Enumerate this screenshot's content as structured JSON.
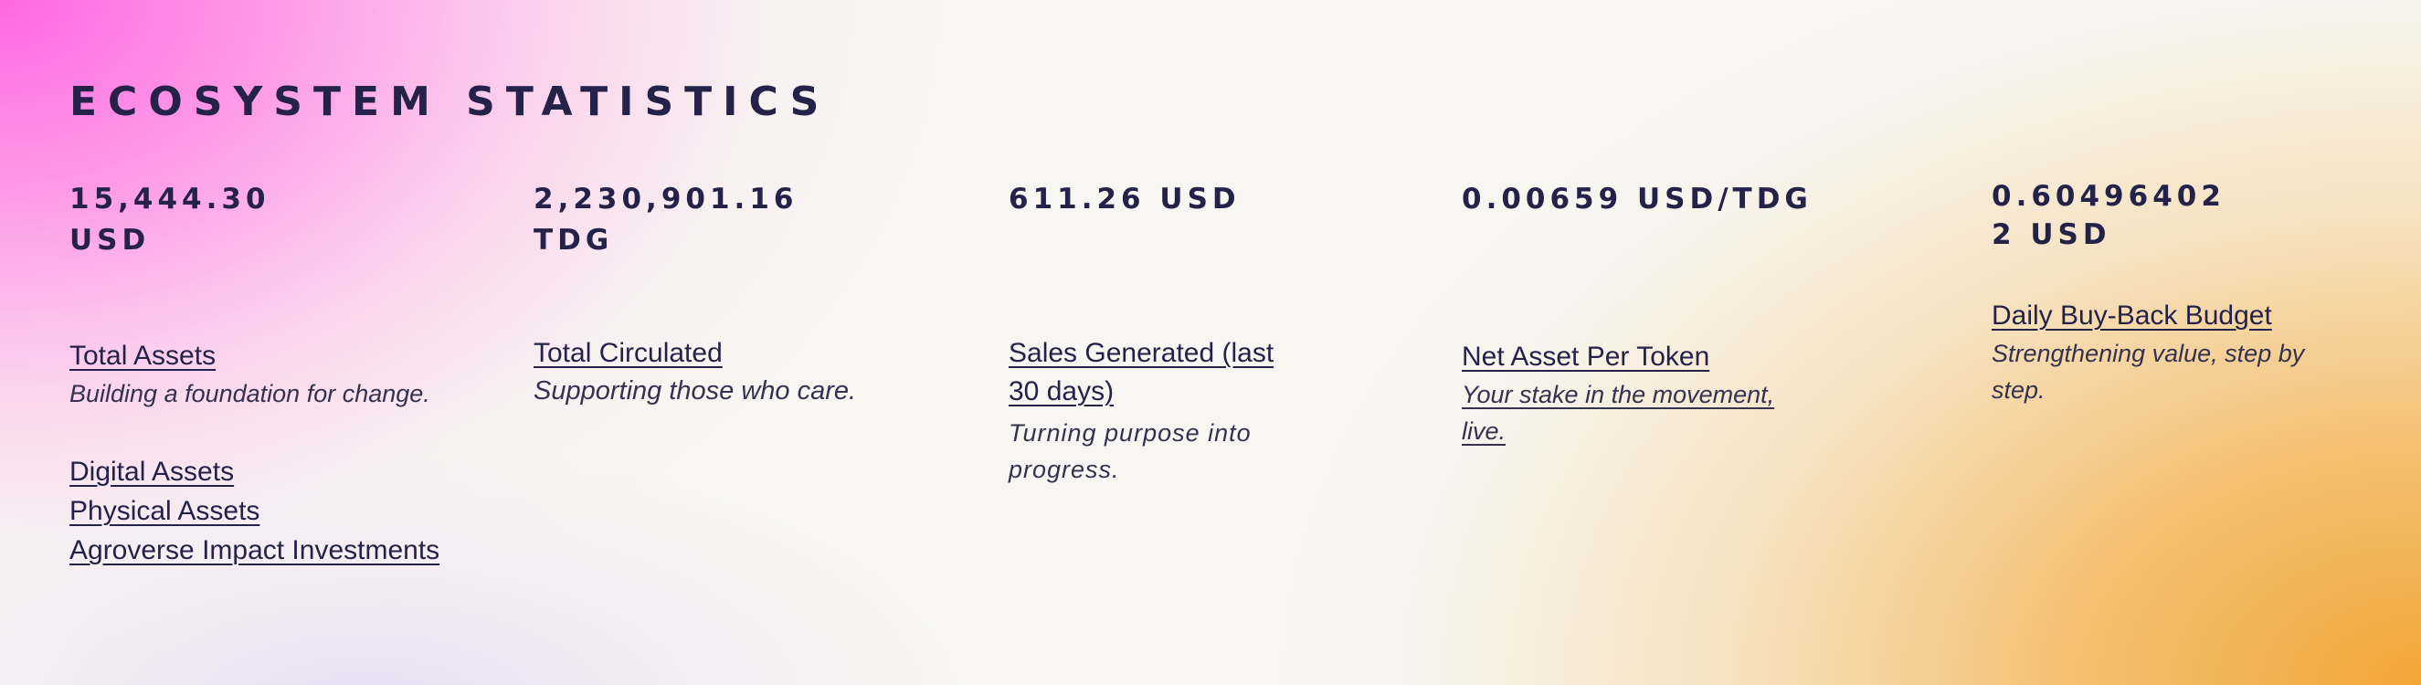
{
  "section": {
    "title": "ECOSYSTEM STATISTICS"
  },
  "stats": [
    {
      "value_line1": "15,444.30",
      "value_line2": "USD",
      "label": "Total Assets",
      "description": "Building a foundation for change.",
      "links": [
        "Digital Assets",
        "Physical Assets",
        "Agroverse Impact Investments"
      ]
    },
    {
      "value_line1": "2,230,901.16",
      "value_line2": "TDG",
      "label": "Total Circulated",
      "description": "Supporting those who care."
    },
    {
      "value_line1": "611.26 USD",
      "label_line1": "Sales Generated (last",
      "label_line2": "30 days)",
      "description_line1": "Turning purpose into",
      "description_line2": "progress."
    },
    {
      "value_line1": "0.00659 USD/TDG",
      "label": "Net Asset Per Token",
      "description_line1": "Your stake in the movement,",
      "description_line2": "live."
    },
    {
      "value_line1": "0.60496402",
      "value_line2": "2 USD",
      "label": "Daily Buy-Back Budget",
      "description_line1": "Strengthening value, step by",
      "description_line2": "step."
    }
  ]
}
